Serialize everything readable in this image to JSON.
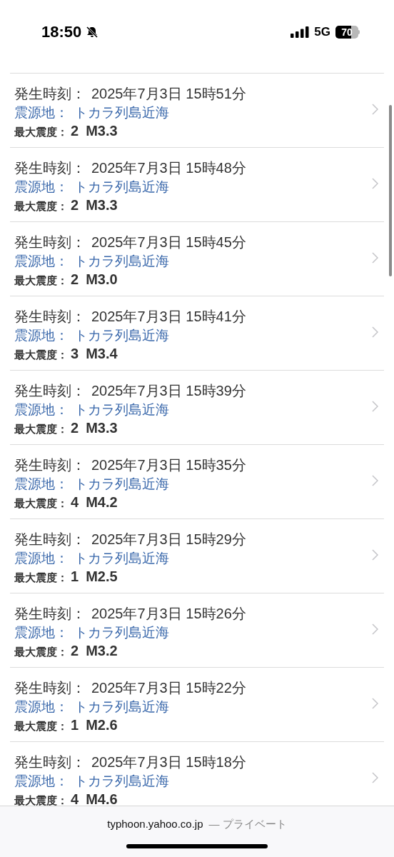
{
  "status_bar": {
    "time": "18:50",
    "network": "5G",
    "battery": "70"
  },
  "quakes": [
    {
      "time_label": "発生時刻：",
      "time": "2025年7月3日 15時51分",
      "epicenter_label": "震源地：",
      "epicenter": "トカラ列島近海",
      "intensity_label": "最大震度：",
      "intensity": "2",
      "magnitude": "M3.3"
    },
    {
      "time_label": "発生時刻：",
      "time": "2025年7月3日 15時48分",
      "epicenter_label": "震源地：",
      "epicenter": "トカラ列島近海",
      "intensity_label": "最大震度：",
      "intensity": "2",
      "magnitude": "M3.3"
    },
    {
      "time_label": "発生時刻：",
      "time": "2025年7月3日 15時45分",
      "epicenter_label": "震源地：",
      "epicenter": "トカラ列島近海",
      "intensity_label": "最大震度：",
      "intensity": "2",
      "magnitude": "M3.0"
    },
    {
      "time_label": "発生時刻：",
      "time": "2025年7月3日 15時41分",
      "epicenter_label": "震源地：",
      "epicenter": "トカラ列島近海",
      "intensity_label": "最大震度：",
      "intensity": "3",
      "magnitude": "M3.4"
    },
    {
      "time_label": "発生時刻：",
      "time": "2025年7月3日 15時39分",
      "epicenter_label": "震源地：",
      "epicenter": "トカラ列島近海",
      "intensity_label": "最大震度：",
      "intensity": "2",
      "magnitude": "M3.3"
    },
    {
      "time_label": "発生時刻：",
      "time": "2025年7月3日 15時35分",
      "epicenter_label": "震源地：",
      "epicenter": "トカラ列島近海",
      "intensity_label": "最大震度：",
      "intensity": "4",
      "magnitude": "M4.2"
    },
    {
      "time_label": "発生時刻：",
      "time": "2025年7月3日 15時29分",
      "epicenter_label": "震源地：",
      "epicenter": "トカラ列島近海",
      "intensity_label": "最大震度：",
      "intensity": "1",
      "magnitude": "M2.5"
    },
    {
      "time_label": "発生時刻：",
      "time": "2025年7月3日 15時26分",
      "epicenter_label": "震源地：",
      "epicenter": "トカラ列島近海",
      "intensity_label": "最大震度：",
      "intensity": "2",
      "magnitude": "M3.2"
    },
    {
      "time_label": "発生時刻：",
      "time": "2025年7月3日 15時22分",
      "epicenter_label": "震源地：",
      "epicenter": "トカラ列島近海",
      "intensity_label": "最大震度：",
      "intensity": "1",
      "magnitude": "M2.6"
    },
    {
      "time_label": "発生時刻：",
      "time": "2025年7月3日 15時18分",
      "epicenter_label": "震源地：",
      "epicenter": "トカラ列島近海",
      "intensity_label": "最大震度：",
      "intensity": "4",
      "magnitude": "M4.6"
    }
  ],
  "address_bar": {
    "domain": "typhoon.yahoo.co.jp",
    "mode": "— プライベート"
  }
}
